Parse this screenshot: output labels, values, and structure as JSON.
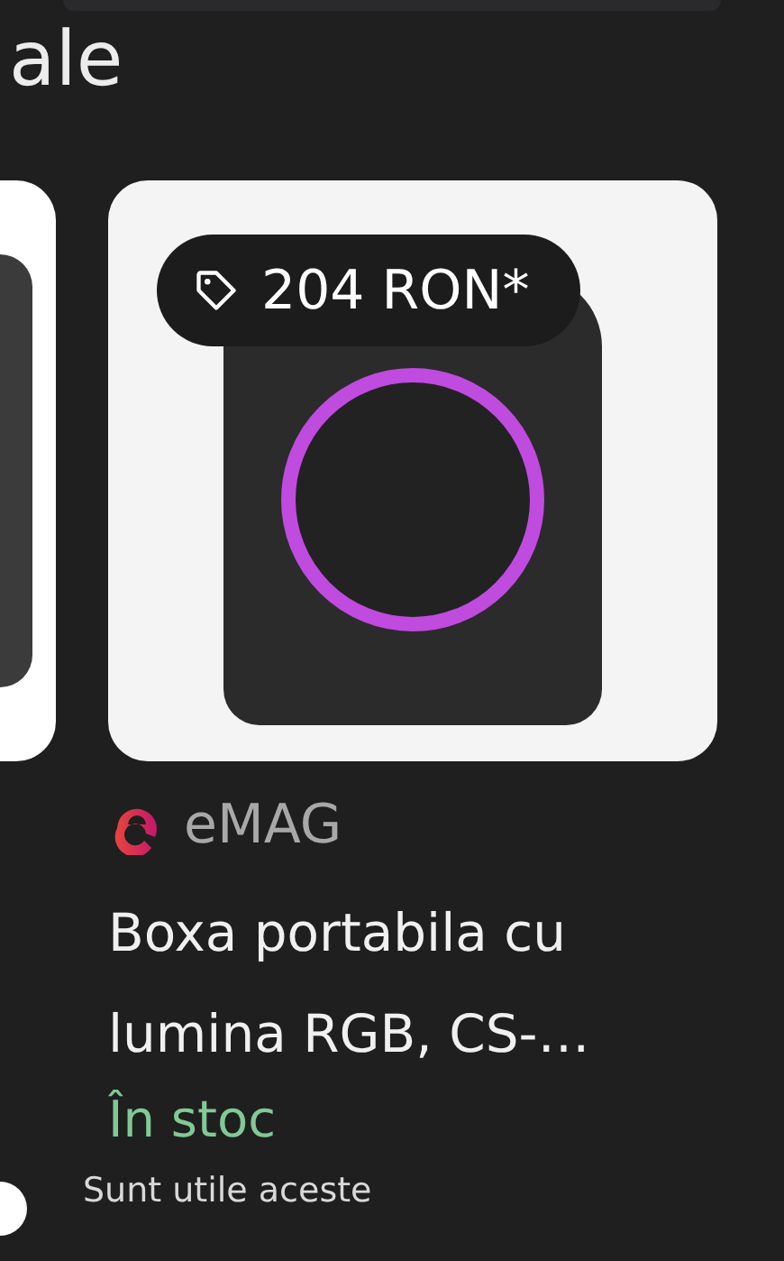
{
  "section_title": "ale",
  "products": [
    {
      "price": "204 RON*",
      "store": "eMAG",
      "title": "Boxa portabila cu lumina RGB, CS-…",
      "availability": "În stoc"
    }
  ],
  "feedback": {
    "question": "Sunt utile aceste"
  }
}
